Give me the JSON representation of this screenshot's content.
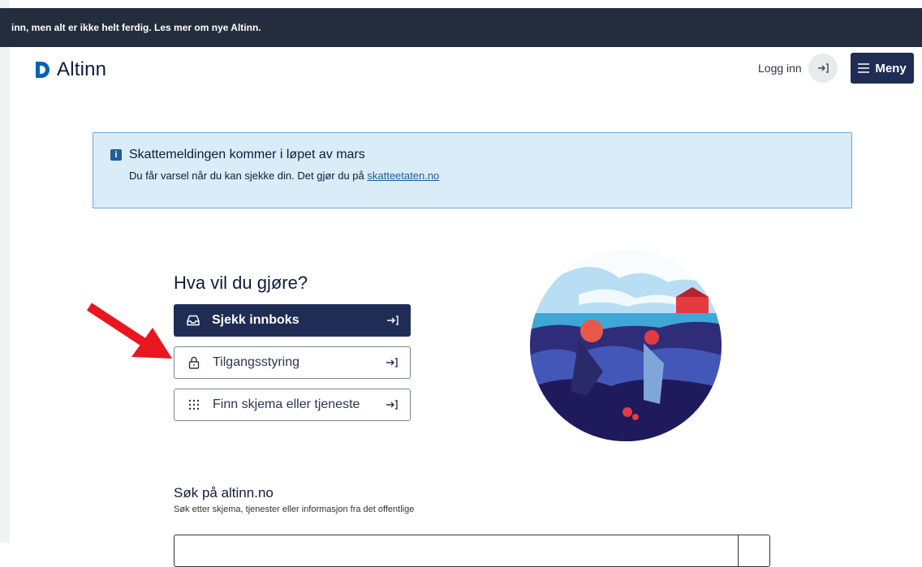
{
  "banner": {
    "text": "inn, men alt er ikke helt ferdig. Les mer om nye Altinn."
  },
  "header": {
    "logo_text": "Altinn",
    "login_label": "Logg inn",
    "menu_label": "Meny"
  },
  "alert": {
    "title": "Skattemeldingen kommer i løpet av mars",
    "body_prefix": "Du får varsel når du kan sjekke din. Det gjør du på ",
    "link_text": "skatteetaten.no"
  },
  "hero": {
    "title": "Hva vil du gjøre?",
    "actions": [
      {
        "label": "Sjekk innboks",
        "icon": "inbox-icon"
      },
      {
        "label": "Tilgangsstyring",
        "icon": "padlock-icon"
      },
      {
        "label": "Finn skjema eller tjeneste",
        "icon": "grid-dots-icon"
      }
    ]
  },
  "search": {
    "title": "Søk på altinn.no",
    "subtitle": "Søk etter skjema, tjenester eller informasjon fra det offentlige",
    "placeholder": ""
  },
  "colors": {
    "primary": "#1f2d55",
    "banner_bg": "#242d3d",
    "alert_bg": "#d9ecf7",
    "alert_border": "#6ea8d0",
    "logo_blue": "#0062ba",
    "annotation_red": "#e8171f"
  }
}
